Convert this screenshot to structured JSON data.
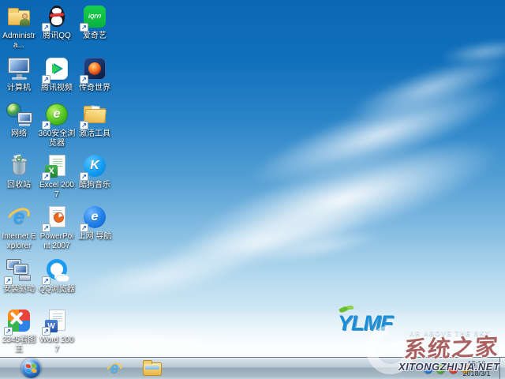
{
  "desktop": {
    "icons": [
      {
        "id": "administrator",
        "label": "Administra..."
      },
      {
        "id": "tencent-qq",
        "label": "腾讯QQ"
      },
      {
        "id": "iqiyi",
        "label": "爱奇艺"
      },
      {
        "id": "computer",
        "label": "计算机"
      },
      {
        "id": "tencent-video",
        "label": "腾讯视频"
      },
      {
        "id": "legend-world",
        "label": "传奇世界"
      },
      {
        "id": "network",
        "label": "网络"
      },
      {
        "id": "360-safe-browser",
        "label": "360安全浏览器"
      },
      {
        "id": "activation-tools",
        "label": "激活工具"
      },
      {
        "id": "recycle-bin",
        "label": "回收站"
      },
      {
        "id": "excel-2007",
        "label": "Excel 2007"
      },
      {
        "id": "kugou-music",
        "label": "酷狗音乐"
      },
      {
        "id": "internet-explorer",
        "label": "Internet Explorer"
      },
      {
        "id": "powerpoint-2007",
        "label": "PowerPoint 2007"
      },
      {
        "id": "web-nav",
        "label": "上网 导航"
      },
      {
        "id": "install-driver",
        "label": "安装驱动"
      },
      {
        "id": "qq-browser",
        "label": "QQ浏览器"
      },
      {
        "id": "2345-picviewer",
        "label": "2345看图王"
      },
      {
        "id": "word-2007",
        "label": "Word 2007"
      }
    ]
  },
  "glyphs": {
    "shortcut_arrow": "↗",
    "iqiyi": "iQIYI",
    "excel": "X",
    "word": "W",
    "kugou": "K",
    "ie": "e",
    "nav": "e",
    "e360": "e",
    "recycle": "♻"
  },
  "branding": {
    "logo_text": "YLMF",
    "tagline": "AR ABOVE THE SKY"
  },
  "watermark": {
    "site_cn": "系统之家",
    "site_en": "XITONGZHIJIA.NET"
  },
  "taskbar": {
    "tray": {
      "time": "15:16",
      "date": "2018/3/1"
    }
  },
  "colors": {
    "sky_top": "#0a67b4",
    "sky_bottom": "#e8f4fb",
    "taskbar": "#a9bcc8",
    "watermark_red": "#801616",
    "logo_blue": "#1b8ed8"
  }
}
